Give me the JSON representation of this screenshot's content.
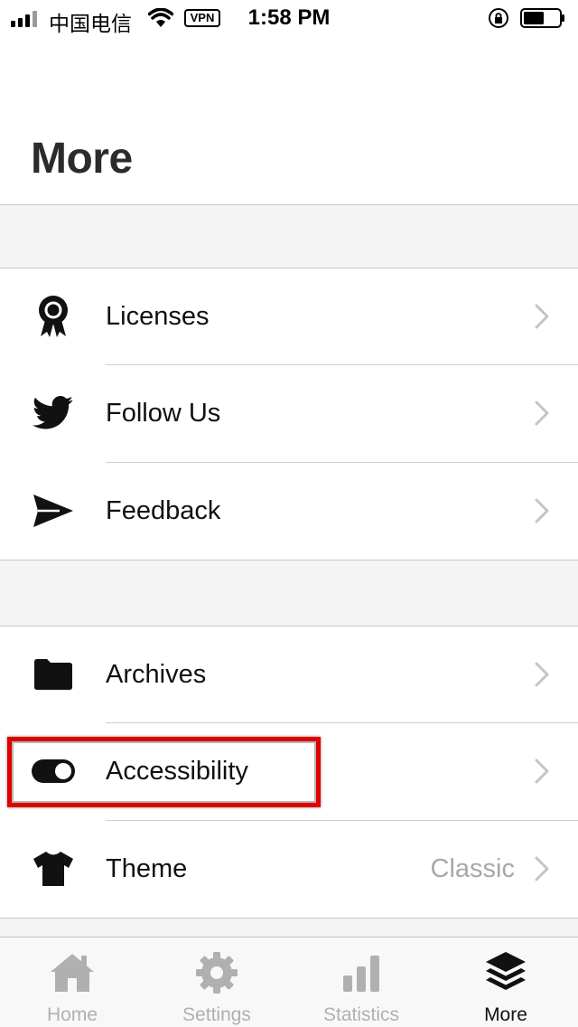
{
  "status_bar": {
    "carrier": "中国电信",
    "vpn": "VPN",
    "time": "1:58 PM"
  },
  "page": {
    "title": "More"
  },
  "sections": [
    {
      "items": [
        {
          "icon": "award-ribbon-icon",
          "label": "Licenses"
        },
        {
          "icon": "twitter-bird-icon",
          "label": "Follow Us"
        },
        {
          "icon": "paper-plane-icon",
          "label": "Feedback"
        }
      ]
    },
    {
      "items": [
        {
          "icon": "folder-icon",
          "label": "Archives"
        },
        {
          "icon": "toggle-switch-icon",
          "label": "Accessibility",
          "highlighted": true
        },
        {
          "icon": "tshirt-icon",
          "label": "Theme",
          "value": "Classic"
        }
      ]
    }
  ],
  "tab_bar": {
    "tabs": [
      {
        "icon": "home-icon",
        "label": "Home",
        "active": false
      },
      {
        "icon": "gear-icon",
        "label": "Settings",
        "active": false
      },
      {
        "icon": "bar-chart-icon",
        "label": "Statistics",
        "active": false
      },
      {
        "icon": "layers-icon",
        "label": "More",
        "active": true
      }
    ]
  },
  "colors": {
    "highlight_border": "#e00000",
    "inactive_tab": "#b0b0b0",
    "active_tab": "#111111",
    "section_band": "#f4f4f4"
  }
}
